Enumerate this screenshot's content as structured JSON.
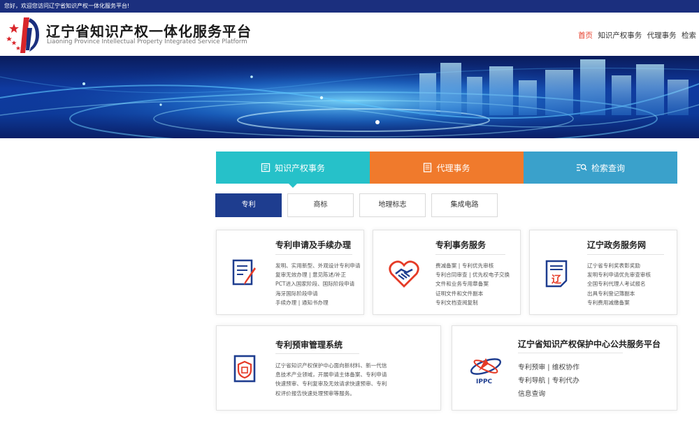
{
  "topbar": {
    "welcome": "您好，欢迎您访问辽宁省知识产权一体化服务平台!"
  },
  "header": {
    "title_cn": "辽宁省知识产权一体化服务平台",
    "title_en": "Liaoning Province Intellectual Property Integrated Service Platform"
  },
  "nav": {
    "items": [
      "首页",
      "知识产权事务",
      "代理事务",
      "检索"
    ]
  },
  "tabs": [
    {
      "label": "知识产权事务",
      "icon": "book-icon",
      "color": "#26c1c9"
    },
    {
      "label": "代理事务",
      "icon": "document-icon",
      "color": "#f07a2c"
    },
    {
      "label": "检索查询",
      "icon": "search-list-icon",
      "color": "#3aa1cb"
    }
  ],
  "subtabs": [
    "专利",
    "商标",
    "地理标志",
    "集成电路"
  ],
  "cards": [
    {
      "title": "专利申请及手续办理",
      "icon": "form-pen-icon",
      "lines": [
        "发明、实用新型、外观设计专利申请",
        "复审无效办理 | 意见陈述/补正",
        "PCT进入国家阶段、国际阶段申请",
        "海牙国际阶段申请",
        "手续办理 | 通知书办理"
      ]
    },
    {
      "title": "专利事务服务",
      "icon": "handshake-heart-icon",
      "lines": [
        "费减备案 | 专利优先审核",
        "专利合同审查 | 优先权电子交换",
        "文件和业务专用章备案",
        "证明文件和文件副本",
        "专利文档查阅复制"
      ]
    },
    {
      "title": "辽宁政务服务网",
      "icon": "liao-document-icon",
      "lines": [
        "辽宁省专利奖表彰奖励",
        "发明专利申请优先审查审核",
        "全国专利代理人考试报名",
        "出具专利登记簿副本",
        "专利费用减缴备案"
      ]
    },
    {
      "title": "专利预审管理系统",
      "icon": "shield-document-icon",
      "lines": [
        "辽宁省知识产权保护中心面向新材料、新一代信",
        "息技术产业领域，开展申请主体备案、专利申请",
        "快速预审、专利复审及无效请求快速预审、专利",
        "权评价报告快速处理预审等服务。"
      ]
    },
    {
      "title": "辽宁省知识产权保护中心公共服务平台",
      "icon": "ippc-logo-icon",
      "logo_text": "IPPC",
      "links": [
        "专利预审 | 维权协作",
        "专利导航 | 专利代办",
        "信息查询"
      ]
    }
  ],
  "colors": {
    "dark_blue": "#1b2f7e",
    "active_red": "#e53a26",
    "teal": "#26c1c9",
    "orange": "#f07a2c",
    "sky": "#3aa1cb",
    "navy": "#1e3d8f"
  }
}
